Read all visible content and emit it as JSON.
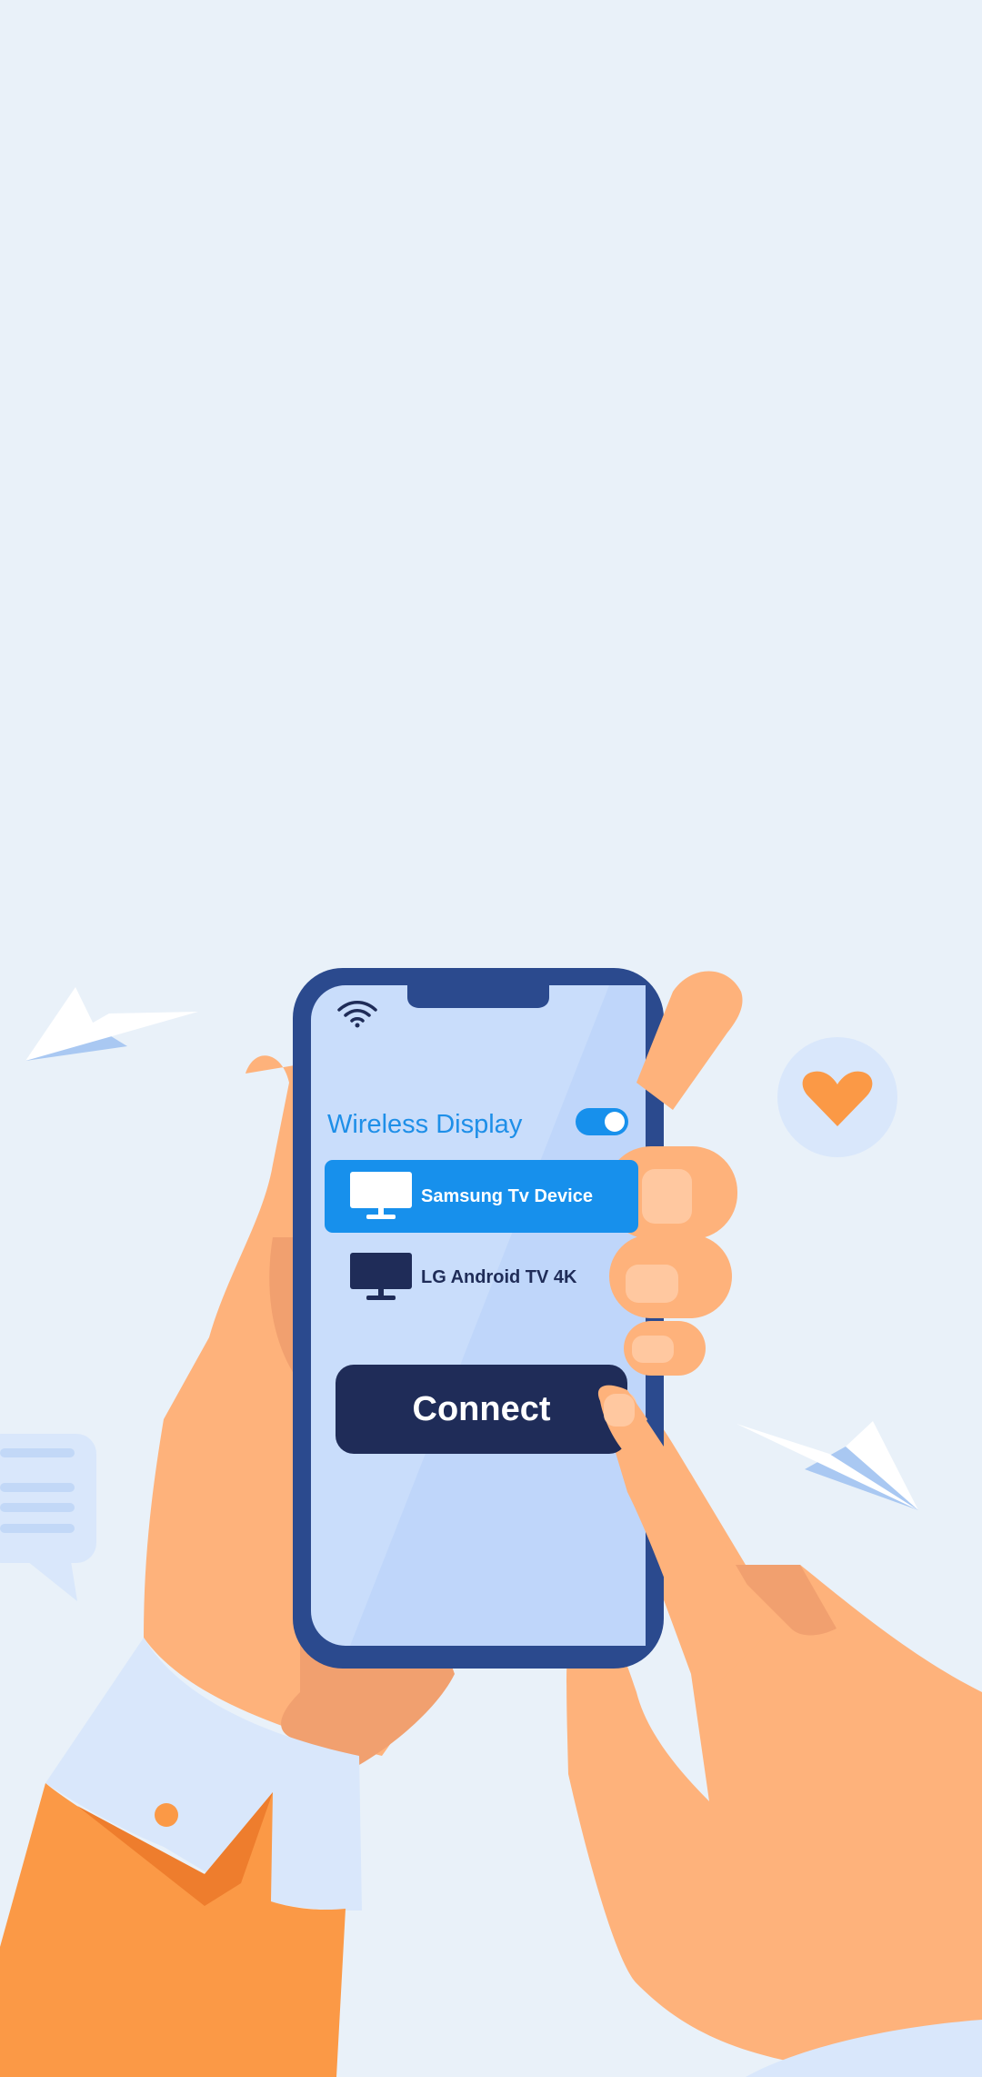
{
  "app": {
    "title": "Wireless Display",
    "toggle_on": true
  },
  "devices": [
    {
      "label": "Samsung Tv Device",
      "selected": true
    },
    {
      "label": "LG Android TV 4K",
      "selected": false
    }
  ],
  "actions": {
    "connect_label": "Connect"
  },
  "icons": {
    "status": "wifi-icon",
    "device": "tv-icon",
    "decor_heart": "heart-icon",
    "decor_chat": "chat-bubble-icon",
    "decor_plane": "paper-plane-icon"
  },
  "colors": {
    "background": "#e9f1f9",
    "accent": "#1790ec",
    "phone_frame": "#2b4a8e",
    "button": "#1f2c58",
    "skin": "#feb27b",
    "sleeve": "#fb9946",
    "heart": "#fb9946"
  }
}
